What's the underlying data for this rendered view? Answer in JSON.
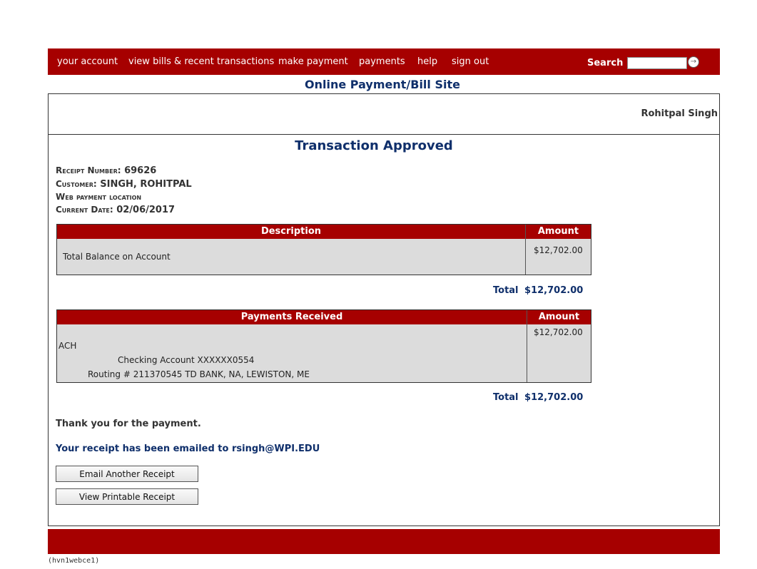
{
  "nav": {
    "items": [
      "your account",
      "view bills & recent transactions",
      "make payment",
      "payments",
      "help",
      "sign out"
    ],
    "search_label": "Search",
    "search_value": ""
  },
  "site_title": "Online Payment/Bill Site",
  "user_name": "Rohitpal Singh",
  "transaction": {
    "title": "Transaction Approved",
    "receipt_label": "Receipt Number:",
    "receipt_number": "69626",
    "customer_label": "Customer:",
    "customer": "SINGH, ROHITPAL",
    "location": "Web payment location",
    "date_label": "Current Date:",
    "date": "02/06/2017"
  },
  "description_table": {
    "headers": [
      "Description",
      "Amount"
    ],
    "rows": [
      {
        "description": "Total Balance on Account",
        "amount": "$12,702.00"
      }
    ],
    "total_label": "Total",
    "total": "$12,702.00"
  },
  "payments_table": {
    "headers": [
      "Payments Received",
      "Amount"
    ],
    "method": "ACH",
    "account": "Checking Account XXXXXX0554",
    "routing": "Routing # 211370545 TD BANK, NA, LEWISTON, ME",
    "amount": "$12,702.00",
    "total_label": "Total",
    "total": "$12,702.00"
  },
  "messages": {
    "thanks": "Thank you for the payment.",
    "emailed": "Your receipt has been emailed to rsingh@WPI.EDU"
  },
  "buttons": {
    "email_another": "Email Another Receipt",
    "view_printable": "View Printable Receipt"
  },
  "footer": {
    "server_id": "(hvn1webce1)"
  },
  "colors": {
    "brand": "#a60000",
    "title": "#0f2f6b",
    "table_bg": "#dcdcdc"
  }
}
